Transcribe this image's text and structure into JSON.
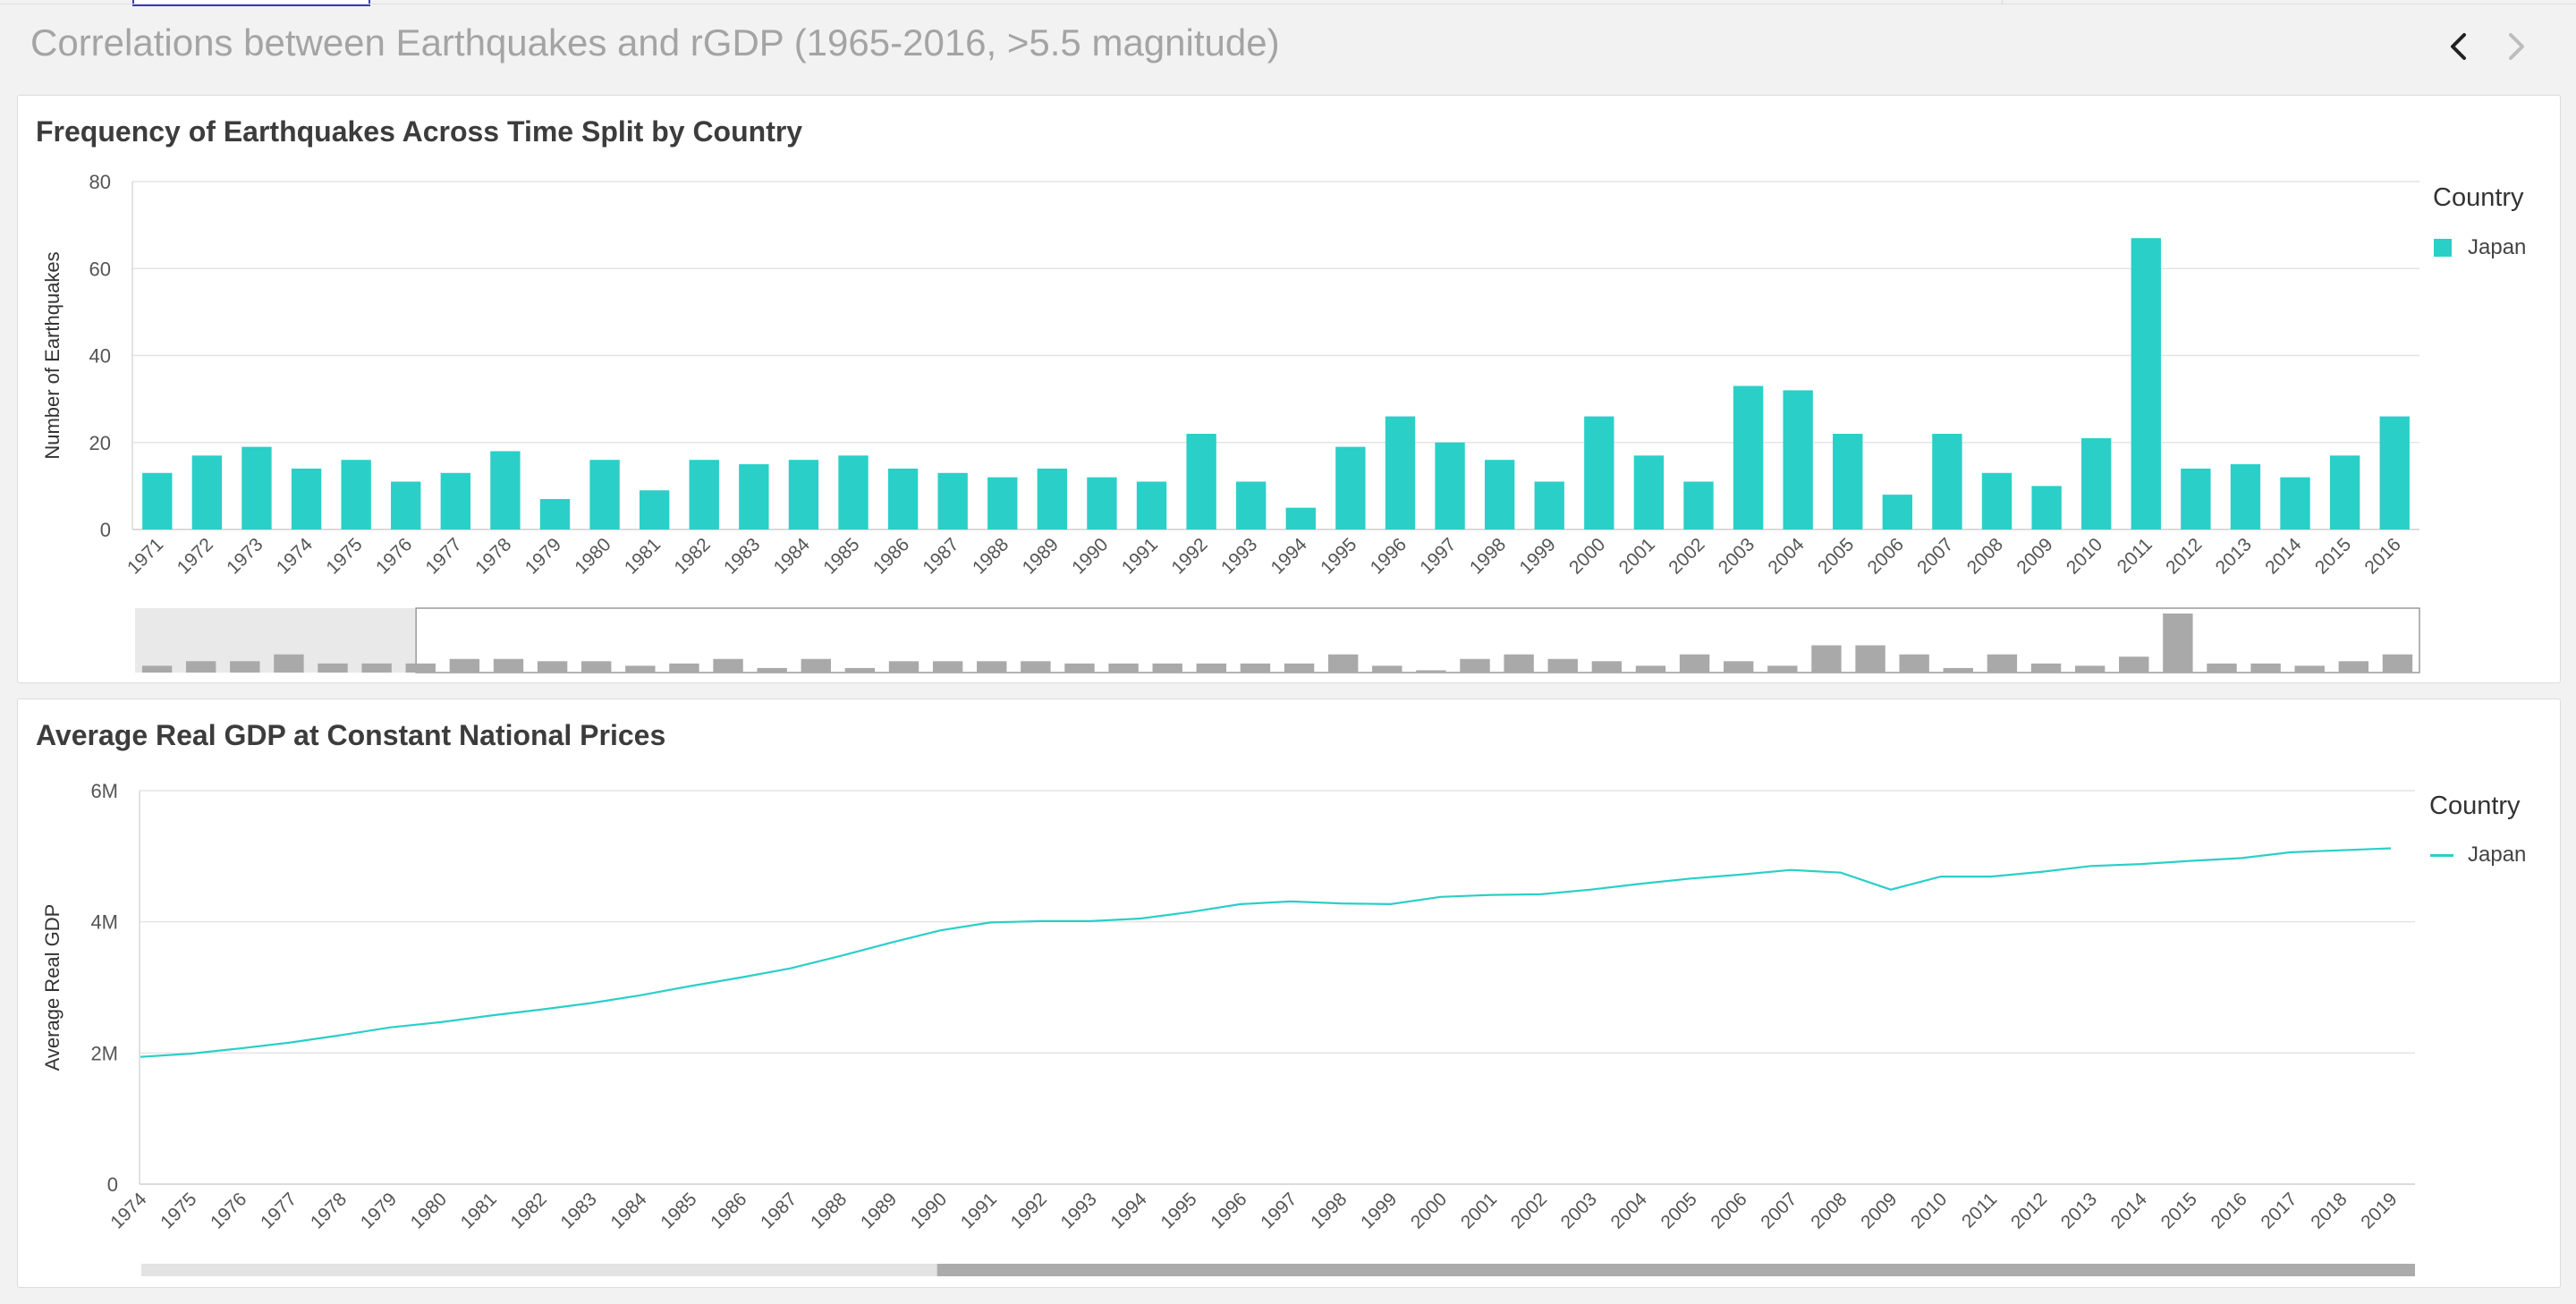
{
  "page": {
    "title": "Correlations between Earthquakes and rGDP (1965-2016, >5.5 magnitude)"
  },
  "nav": {
    "prev_icon": "chevron-left-icon",
    "next_icon": "chevron-right-icon"
  },
  "colors": {
    "series": "#2acfc8",
    "brush_bar": "#a9a9a9",
    "grid": "#e4e4e4",
    "scroll_track": "#e3e3e3",
    "scroll_thumb": "#ababab"
  },
  "chart_data": [
    {
      "type": "bar",
      "title": "Frequency of Earthquakes Across Time Split by Country",
      "xlabel": "",
      "ylabel": "Number of Earthquakes",
      "ylim": [
        0,
        80
      ],
      "yticks": [
        0,
        20,
        40,
        60,
        80
      ],
      "yticklabels": [
        "0",
        "20",
        "40",
        "60",
        "80"
      ],
      "grid": true,
      "legend_title": "Country",
      "legend_position": "right",
      "categories": [
        "1971",
        "1972",
        "1973",
        "1974",
        "1975",
        "1976",
        "1977",
        "1978",
        "1979",
        "1980",
        "1981",
        "1982",
        "1983",
        "1984",
        "1985",
        "1986",
        "1987",
        "1988",
        "1989",
        "1990",
        "1991",
        "1992",
        "1993",
        "1994",
        "1995",
        "1996",
        "1997",
        "1998",
        "1999",
        "2000",
        "2001",
        "2002",
        "2003",
        "2004",
        "2005",
        "2006",
        "2007",
        "2008",
        "2009",
        "2010",
        "2011",
        "2012",
        "2013",
        "2014",
        "2015",
        "2016"
      ],
      "series": [
        {
          "name": "Japan",
          "values": [
            13,
            17,
            19,
            14,
            16,
            11,
            13,
            18,
            7,
            16,
            9,
            16,
            15,
            16,
            17,
            14,
            13,
            12,
            14,
            12,
            11,
            22,
            11,
            5,
            19,
            26,
            20,
            16,
            11,
            26,
            17,
            11,
            33,
            32,
            22,
            8,
            22,
            13,
            10,
            21,
            67,
            14,
            15,
            12,
            17,
            26
          ]
        }
      ],
      "brush": {
        "values": [
          3,
          5,
          5,
          8,
          4,
          4,
          4,
          6,
          6,
          5,
          5,
          3,
          4,
          6,
          2,
          6,
          2,
          5,
          5,
          5,
          5,
          4,
          4,
          4,
          4,
          4,
          4,
          8,
          3,
          1,
          6,
          8,
          6,
          5,
          3,
          8,
          5,
          3,
          12,
          12,
          8,
          2,
          8,
          4,
          3,
          7,
          26,
          4,
          4,
          3,
          5,
          8
        ],
        "selection_start_fraction": 0.123
      }
    },
    {
      "type": "line",
      "title": "Average Real GDP at Constant National Prices",
      "xlabel": "",
      "ylabel": "Average Real GDP",
      "ylim": [
        0,
        6000000
      ],
      "yticks": [
        0,
        2000000,
        4000000,
        6000000
      ],
      "yticklabels": [
        "0",
        "2M",
        "4M",
        "6M"
      ],
      "grid": true,
      "legend_title": "Country",
      "legend_position": "right",
      "x": [
        "1974",
        "1975",
        "1976",
        "1977",
        "1978",
        "1979",
        "1980",
        "1981",
        "1982",
        "1983",
        "1984",
        "1985",
        "1986",
        "1987",
        "1988",
        "1989",
        "1990",
        "1991",
        "1992",
        "1993",
        "1994",
        "1995",
        "1996",
        "1997",
        "1998",
        "1999",
        "2000",
        "2001",
        "2002",
        "2003",
        "2004",
        "2005",
        "2006",
        "2007",
        "2008",
        "2009",
        "2010",
        "2011",
        "2012",
        "2013",
        "2014",
        "2015",
        "2016",
        "2017",
        "2018",
        "2019"
      ],
      "series": [
        {
          "name": "Japan",
          "values": [
            1940000,
            1990000,
            2070000,
            2160000,
            2270000,
            2390000,
            2470000,
            2570000,
            2660000,
            2760000,
            2880000,
            3020000,
            3150000,
            3290000,
            3480000,
            3680000,
            3870000,
            3990000,
            4010000,
            4010000,
            4050000,
            4150000,
            4270000,
            4310000,
            4280000,
            4270000,
            4380000,
            4410000,
            4420000,
            4490000,
            4580000,
            4660000,
            4720000,
            4790000,
            4750000,
            4490000,
            4690000,
            4690000,
            4760000,
            4850000,
            4880000,
            4930000,
            4970000,
            5060000,
            5090000,
            5120000
          ]
        }
      ],
      "scrollbar": {
        "visible_start_fraction": 0.35,
        "visible_end_fraction": 1.0
      }
    }
  ]
}
